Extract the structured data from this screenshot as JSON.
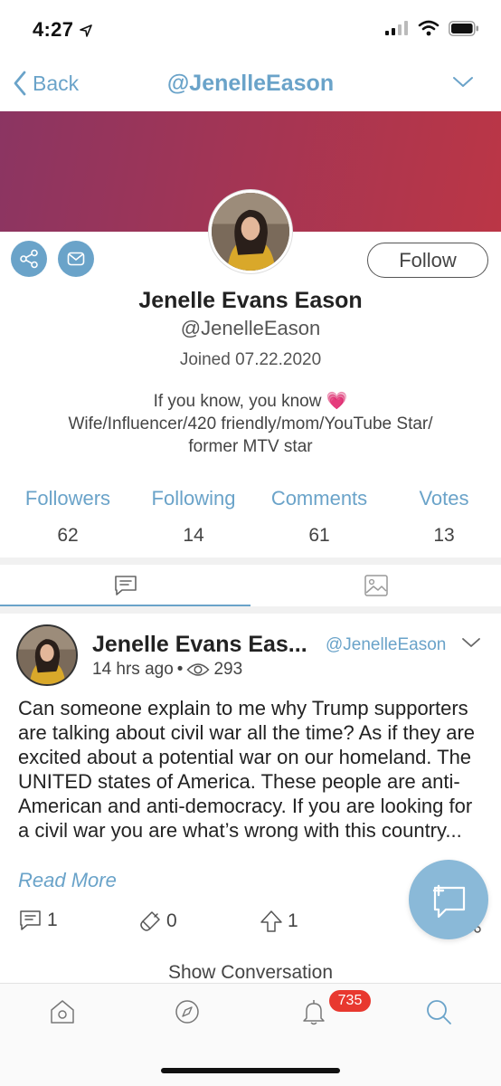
{
  "status_bar": {
    "time": "4:27"
  },
  "nav": {
    "back_label": "Back",
    "title": "@JenelleEason"
  },
  "profile": {
    "name": "Jenelle Evans Eason",
    "handle": "@JenelleEason",
    "joined": "Joined 07.22.2020",
    "bio_line1": "If you know, you know 💗",
    "bio_line2": "Wife/Influencer/420 friendly/mom/YouTube Star/",
    "bio_line3": "former MTV star",
    "follow_label": "Follow"
  },
  "stats": [
    {
      "label": "Followers",
      "value": "62"
    },
    {
      "label": "Following",
      "value": "14"
    },
    {
      "label": "Comments",
      "value": "61"
    },
    {
      "label": "Votes",
      "value": "13"
    }
  ],
  "post": {
    "author": "Jenelle Evans Eas...",
    "handle": "@JenelleEason",
    "time": "14 hrs ago",
    "views": "293",
    "body": "Can someone explain to me why Trump supporters are talking about civil war all the time? As if they are excited about a potential war on our homeland. The UNITED states of America. These people are anti-American and anti-democracy. If you are looking for a civil war you are what’s wrong with this country...",
    "read_more": "Read More",
    "comments_count": "1",
    "flags_count": "0",
    "upvotes_count": "1",
    "show_conversation": "Show Conversation"
  },
  "tabbar": {
    "notifications_badge": "735"
  },
  "colors": {
    "accent": "#6aa3c9",
    "banner_start": "#8b3562",
    "banner_end": "#bb3646",
    "badge": "#e8382f"
  }
}
